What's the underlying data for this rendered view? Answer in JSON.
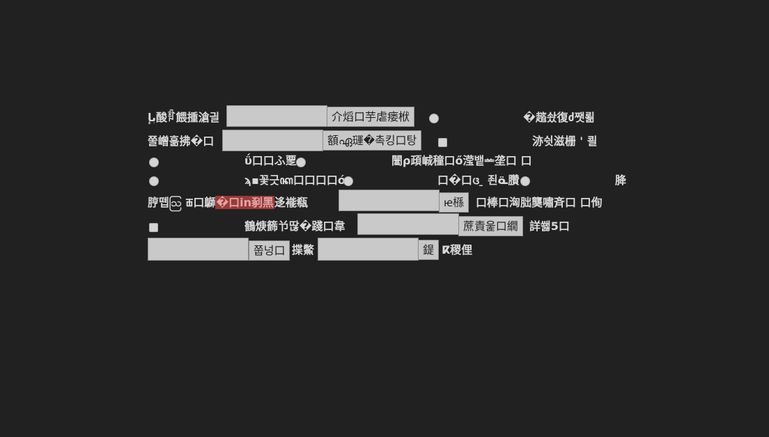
{
  "rows": {
    "r1": {
      "label": "بإ酸ꆋ餵揰滄긜",
      "button": "介熖口芋虐瘘栿",
      "right_label": "�趦솼復ძ쨋",
      "right_label_tail": "뢺"
    },
    "r2": {
      "label": "쭐嶒흚拂�口",
      "button": "額ഏ璭�촉킹口탕",
      "right_label": "洂쉿滋栅 ' 쾰"
    },
    "r3": {
      "label_a": "ΰ口口ふ覂",
      "label_b": "闣ρ頙峸穜口ő滢뱉ᆇ垄口",
      "label_b_tail": "口"
    },
    "r4": {
      "label_a": "ϡ▪꽃긋ꦏ口口口口ó",
      "label_b": "口�口ᨴ ̱ 죈ᓏ臢",
      "label_c": "胮"
    },
    "r5": {
      "label_prefix": "脝뗍ဩ ꫥ口鶳",
      "label_highlight": "�口in剢黑",
      "label_suffix": "迻褦瓻",
      "button": "ꭡ槂",
      "right_label": "口棒口洶朏龑嘯斉口  口侚"
    },
    "r6": {
      "label": "鶴焿籂兯딶�踐口韋",
      "button": "蔗責욽口繝",
      "right_label": "詳쐟5口"
    },
    "r7": {
      "button_a": "쭙넝口",
      "label": "揲鱉",
      "button_b": "鍉",
      "right_label": "ⴽ稷俚"
    }
  }
}
